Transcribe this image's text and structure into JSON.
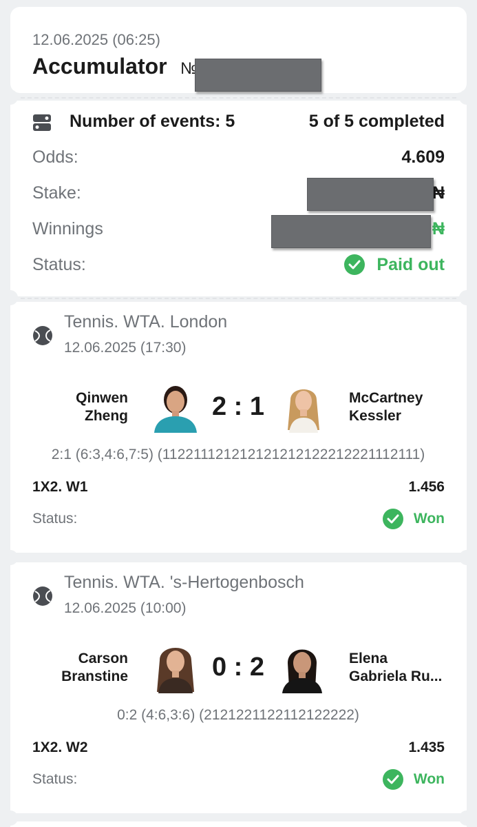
{
  "header": {
    "datetime": "12.06.2025 (06:25)",
    "bet_type": "Accumulator",
    "bet_number_prefix": "№"
  },
  "summary": {
    "events_label": "Number of events: 5",
    "completed_label": "5 of 5 completed",
    "odds_label": "Odds:",
    "odds_value": "4.609",
    "stake_label": "Stake:",
    "stake_currency": "₦",
    "winnings_label": "Winnings",
    "winnings_currency": "₦",
    "status_label": "Status:",
    "status_value": "Paid out"
  },
  "events": [
    {
      "tournament": "Tennis. WTA. London",
      "datetime": "12.06.2025 (17:30)",
      "player1_line1": "Qinwen",
      "player1_line2": "Zheng",
      "score": "2 : 1",
      "player2_line1": "McCartney",
      "player2_line2": "Kessler",
      "details": "2:1 (6:3,4:6,7:5) (112211121212121212122212221112111)",
      "market": "1X2. W1",
      "odds": "1.456",
      "status_label": "Status:",
      "status_value": "Won"
    },
    {
      "tournament": "Tennis. WTA. 's-Hertogenbosch",
      "datetime": "12.06.2025 (10:00)",
      "player1_line1": "Carson",
      "player1_line2": "Branstine",
      "score": "0 : 2",
      "player2_line1": "Elena",
      "player2_line2": "Gabriela Ru...",
      "details": "0:2 (4:6,3:6) (2121221122112122222)",
      "market": "1X2. W2",
      "odds": "1.435",
      "status_label": "Status:",
      "status_value": "Won"
    }
  ],
  "colors": {
    "accent_green": "#3db55e",
    "background": "#eef0f2",
    "card": "#ffffff",
    "redaction": "#6b6d70"
  },
  "icons": [
    "ticket-icon",
    "tennis-ball-icon",
    "check-circle-icon"
  ]
}
